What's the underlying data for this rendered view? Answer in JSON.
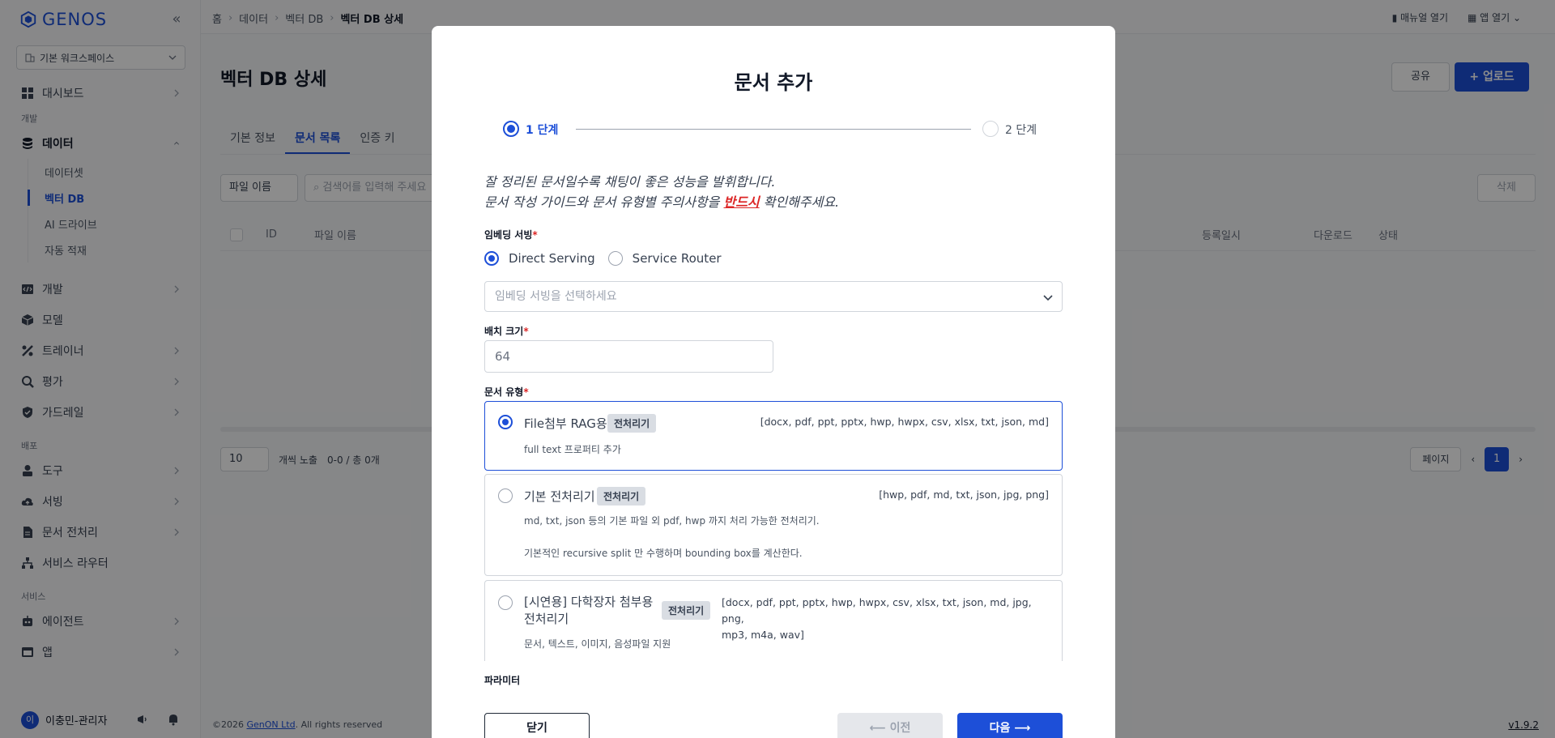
{
  "app": {
    "logo_text": "GENOS",
    "accent": "#1d4fd8"
  },
  "sidebar": {
    "workspace": "기본 워크스페이스",
    "items": {
      "dashboard": "대시보드",
      "group_dev": "개발",
      "data": "데이터",
      "dataset": "데이터셋",
      "vector_db": "벡터 DB",
      "ai_drive": "AI 드라이브",
      "auto_load": "자동 적재",
      "dev": "개발",
      "model": "모델",
      "trainer": "트레이너",
      "eval": "평가",
      "guardrail": "가드레일",
      "group_deploy": "배포",
      "tool": "도구",
      "serving": "서빙",
      "doc_preprocess": "문서 전처리",
      "service_router": "서비스 라우터",
      "group_service": "서비스",
      "agent": "에이전트",
      "app": "앱"
    },
    "user": {
      "initial": "이",
      "name": "이충민-관리자"
    }
  },
  "topbar": {
    "breadcrumb": [
      "홈",
      "데이터",
      "벡터 DB",
      "벡터 DB 상세"
    ],
    "manual": "매뉴얼 열기",
    "open_app": "앱 열기"
  },
  "page": {
    "title": "벡터 DB 상세",
    "share": "공유",
    "upload": "업로드",
    "tabs": [
      "기본 정보",
      "문서 목록",
      "인증 키"
    ],
    "filter": "파일 이름",
    "search_placeholder": "검색어를 입력해 주세요",
    "delete": "삭제",
    "columns": [
      "ID",
      "파일 이름",
      "등록일시",
      "다운로드",
      "상태"
    ],
    "page_size": "10",
    "page_size_label": "개씩 노출",
    "count": "0-0 / 총 0개",
    "page_label": "페이지",
    "current_page": "1",
    "copyright_prefix": "©2026",
    "copyright_link": "GenON Ltd",
    "copyright_suffix": ". All rights reserved",
    "version": "v1.9.2"
  },
  "modal": {
    "title": "문서 추가",
    "step1": "1 단계",
    "step2": "2 단계",
    "guide_line1": "잘 정리된 문서일수록 채팅이 좋은 성능을 발휘합니다.",
    "guide_line2_pre": "문서 작성 가이드와 문서 유형별 주의사항을 ",
    "guide_line2_must": "반드시",
    "guide_line2_post": " 확인해주세요.",
    "embedding_label": "임베딩 서빙",
    "embedding_options": [
      "Direct Serving",
      "Service Router"
    ],
    "embedding_placeholder": "임베딩 서빙을 선택하세요",
    "batch_label": "배치 크기",
    "batch_value": "64",
    "doctype_label": "문서 유형",
    "doctypes": [
      {
        "title": "File첨부 RAG용",
        "tag": "전처리기",
        "ext": "[docx, pdf, ppt, pptx, hwp, hwpx, csv, xlsx, txt, json, md]",
        "desc": "full text 프로퍼티 추가"
      },
      {
        "title": "기본 전처리기",
        "tag": "전처리기",
        "ext": "[hwp, pdf, md, txt, json, jpg, png]",
        "desc": "md, txt, json 등의 기본 파일 외 pdf, hwp 까지 처리 가능한 전처리기.",
        "desc2": "기본적인 recursive split 만 수행하며 bounding box를 계산한다."
      },
      {
        "title_line1": "[시연용] 다학장자 첨부용",
        "title_line2": "전처리기",
        "tag": "전처리기",
        "ext_line1": "[docx, pdf, ppt, pptx, hwp, hwpx, csv, xlsx, txt, json, md, jpg, png,",
        "ext_line2": "mp3, m4a, wav]",
        "desc": "문서, 텍스트, 이미지, 음성파일 지원"
      }
    ],
    "param_label": "파라미터",
    "close": "닫기",
    "prev": "이전",
    "next": "다음"
  }
}
